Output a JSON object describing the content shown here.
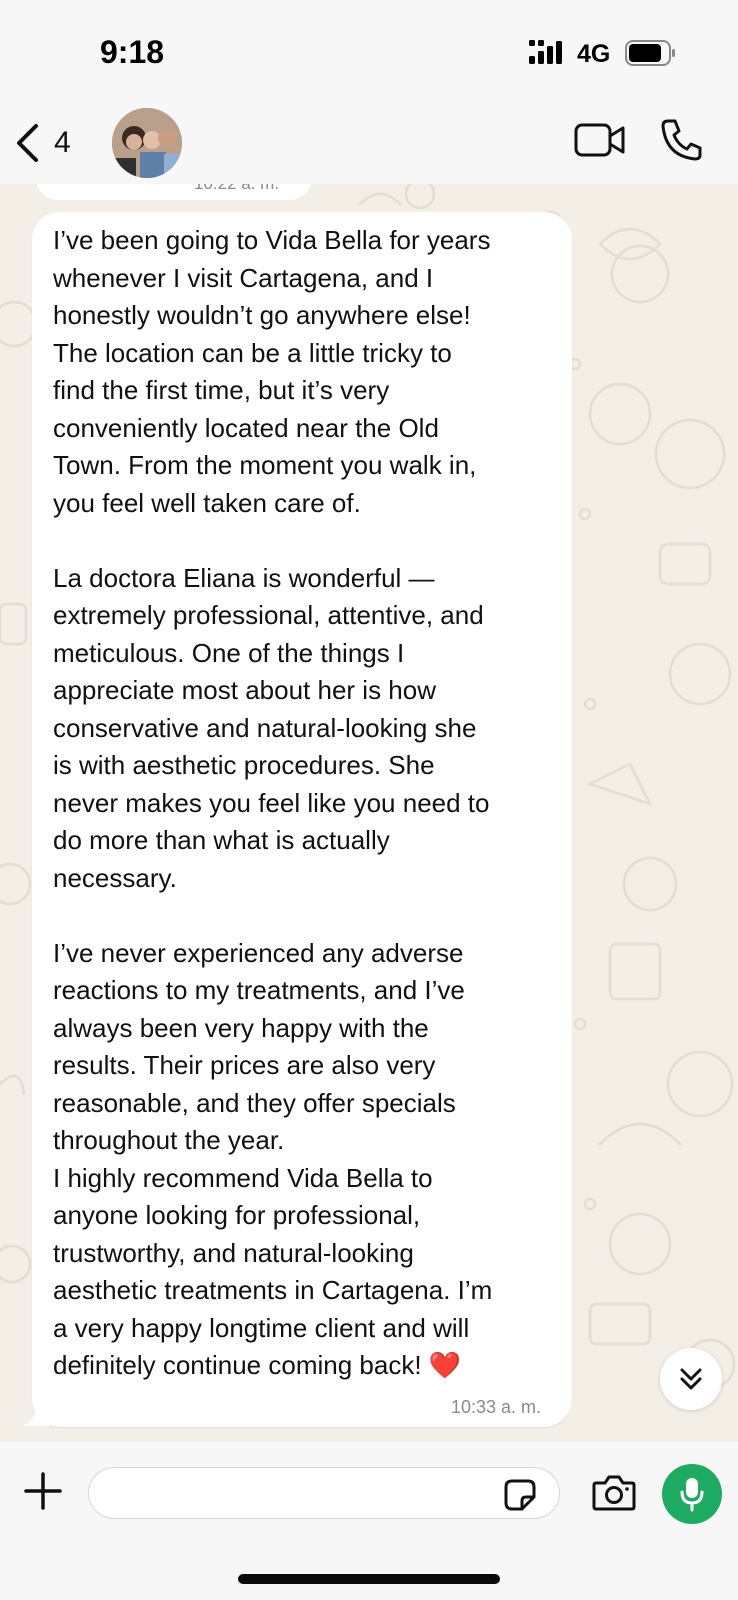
{
  "status_bar": {
    "time": "9:18",
    "network": "4G"
  },
  "header": {
    "back_count": "4"
  },
  "previous_message": {
    "time": "10:22 a. m."
  },
  "message": {
    "paragraphs": [
      [
        "I’ve been going to Vida Bella for years",
        "whenever I visit Cartagena, and I",
        "honestly wouldn’t go anywhere else!",
        "The location can be a little tricky to",
        "find the first time, but it’s very",
        "conveniently located near the Old",
        "Town. From the moment you walk in,",
        "you feel well taken care of."
      ],
      [
        "La doctora Eliana is wonderful —",
        "extremely professional, attentive, and",
        "meticulous. One of the things I",
        "appreciate most about her is how",
        "conservative and natural-looking she",
        "is with aesthetic procedures. She",
        "never makes you feel like you need to",
        "do more than what is actually",
        "necessary."
      ],
      [
        "I’ve never experienced any adverse",
        "reactions to my treatments, and I’ve",
        "always been very happy with the",
        "results. Their prices are also very",
        "reasonable, and they offer specials",
        "throughout the year.",
        "I highly recommend Vida Bella to",
        "anyone looking for professional,",
        "trustworthy, and natural-looking",
        "aesthetic treatments in Cartagena. I’m",
        "a very happy longtime client and will",
        "definitely continue coming back! ❤️"
      ]
    ],
    "time": "10:33 a. m."
  },
  "input": {
    "placeholder": ""
  },
  "colors": {
    "accent_green": "#1daa61",
    "bubble": "#ffffff",
    "wallpaper": "#f3efe6"
  },
  "icons": [
    "chevron-left-icon",
    "video-camera-icon",
    "phone-icon",
    "plus-icon",
    "sticker-icon",
    "camera-icon",
    "microphone-icon",
    "double-chevron-down-icon",
    "signal-icon",
    "battery-icon"
  ]
}
